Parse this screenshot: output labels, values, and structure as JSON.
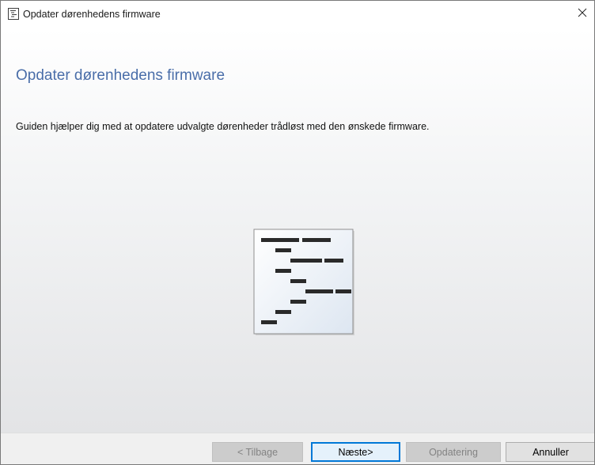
{
  "window": {
    "title": "Opdater dørenhedens firmware",
    "app_icon": "wizard-document-icon",
    "close_icon": "close-icon"
  },
  "wizard": {
    "heading": "Opdater dørenhedens firmware",
    "description": "Guiden hjælper dig med at opdatere udvalgte dørenheder trådløst med den ønskede firmware.",
    "illustration_icon": "code-document-icon"
  },
  "buttons": {
    "back": {
      "label": "< Tilbage",
      "enabled": false
    },
    "next": {
      "label": "Næste>",
      "enabled": true,
      "default": true
    },
    "update": {
      "label": "Opdatering",
      "enabled": false
    },
    "cancel": {
      "label": "Annuller",
      "enabled": true
    }
  },
  "colors": {
    "heading": "#4a6ea9",
    "focus_border": "#0078d7"
  }
}
